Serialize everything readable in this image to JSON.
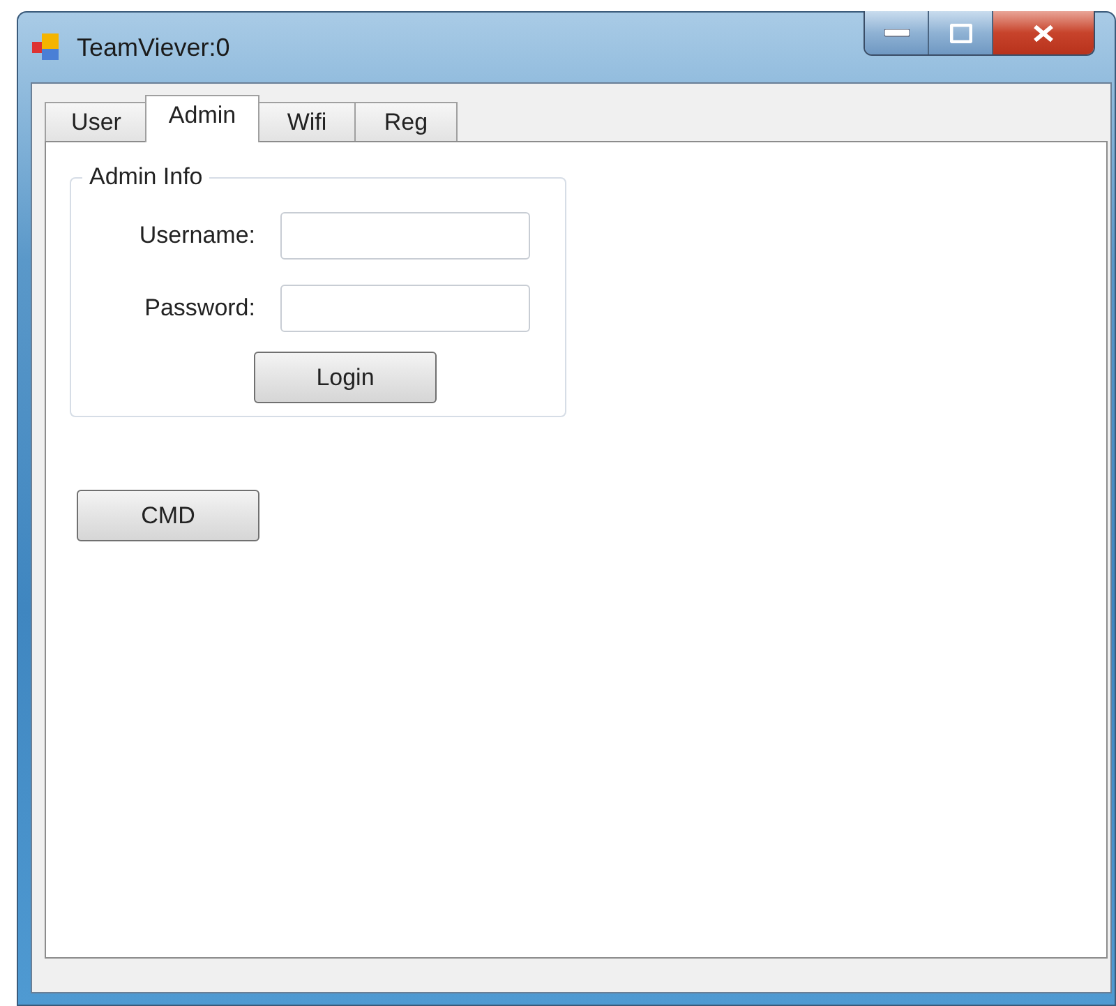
{
  "window": {
    "title": "TeamViever:0"
  },
  "tabs": [
    {
      "label": "User",
      "selected": false
    },
    {
      "label": "Admin",
      "selected": true
    },
    {
      "label": "Wifi",
      "selected": false
    },
    {
      "label": "Reg",
      "selected": false
    }
  ],
  "group": {
    "title": "Admin Info",
    "fields": [
      {
        "label": "Username:"
      },
      {
        "label": "Password:"
      }
    ],
    "button": "Login"
  },
  "buttons": [
    "CMD"
  ]
}
